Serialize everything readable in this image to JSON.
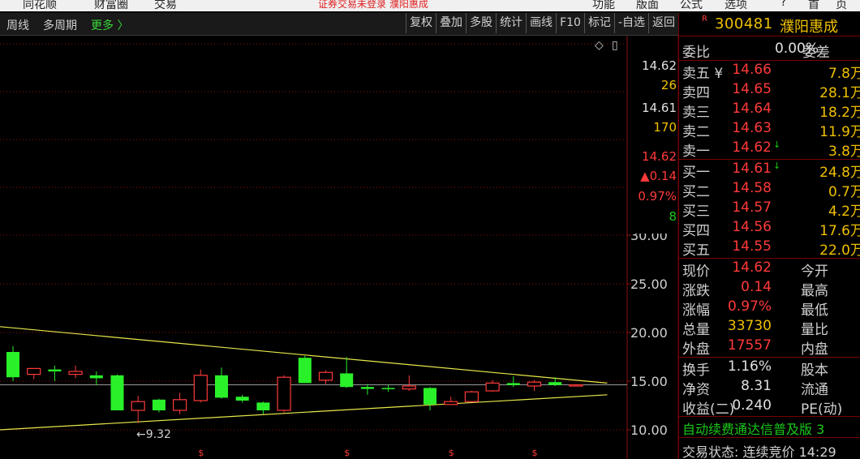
{
  "menubar": {
    "items": [
      "同花顺",
      "财富圈",
      "交易"
    ],
    "warning": "证券交易未登录  濮阳惠成",
    "right_items": [
      "功能",
      "版面",
      "公式",
      "选项",
      "?",
      "首",
      "页"
    ]
  },
  "toolbar": {
    "left": [
      "周线",
      "多周期"
    ],
    "more": "更多 〉",
    "right": [
      "复权",
      "叠加",
      "多股",
      "统计",
      "画线",
      "F10",
      "标记",
      "-自选",
      "返回"
    ]
  },
  "chart": {
    "corner_icons": [
      "◇",
      "▯"
    ],
    "mini_quotes": [
      {
        "text": "14.62",
        "color": "#e0e0e0"
      },
      {
        "text": "26",
        "color": "#f0c000"
      },
      {
        "text": "14.61",
        "color": "#e0e0e0"
      },
      {
        "text": "170",
        "color": "#f0c000"
      },
      {
        "text": "14.62",
        "color": "#ff3a3a"
      },
      {
        "text": "▲0.14",
        "color": "#ff3a3a"
      },
      {
        "text": "0.97%",
        "color": "#ff3a3a"
      },
      {
        "text": "8",
        "color": "#19c819"
      }
    ],
    "low_label": "←9.32",
    "marker": "$"
  },
  "chart_data": {
    "type": "candlestick",
    "y_ticks": [
      "30.00",
      "25.00",
      "20.00",
      "15.00",
      "10.00"
    ],
    "ylim": [
      10,
      30
    ],
    "candles": [
      {
        "o": 18.0,
        "h": 18.6,
        "l": 15.0,
        "c": 15.4
      },
      {
        "o": 15.7,
        "h": 16.3,
        "l": 15.2,
        "c": 16.3
      },
      {
        "o": 16.2,
        "h": 16.6,
        "l": 15.0,
        "c": 16.0
      },
      {
        "o": 15.7,
        "h": 16.6,
        "l": 15.3,
        "c": 16.0
      },
      {
        "o": 15.6,
        "h": 16.0,
        "l": 14.6,
        "c": 15.3
      },
      {
        "o": 15.6,
        "h": 15.7,
        "l": 12.0,
        "c": 12.0
      },
      {
        "o": 12.0,
        "h": 13.5,
        "l": 10.7,
        "c": 12.9
      },
      {
        "o": 13.1,
        "h": 13.2,
        "l": 11.8,
        "c": 12.0
      },
      {
        "o": 12.0,
        "h": 13.8,
        "l": 11.6,
        "c": 13.1
      },
      {
        "o": 13.0,
        "h": 16.2,
        "l": 12.8,
        "c": 15.6
      },
      {
        "o": 15.6,
        "h": 16.4,
        "l": 13.2,
        "c": 13.3
      },
      {
        "o": 13.4,
        "h": 13.6,
        "l": 12.8,
        "c": 13.0
      },
      {
        "o": 12.8,
        "h": 12.9,
        "l": 11.6,
        "c": 12.0
      },
      {
        "o": 12.0,
        "h": 15.6,
        "l": 11.8,
        "c": 15.4
      },
      {
        "o": 17.4,
        "h": 17.6,
        "l": 14.8,
        "c": 14.8
      },
      {
        "o": 15.1,
        "h": 16.1,
        "l": 14.7,
        "c": 15.9
      },
      {
        "o": 15.8,
        "h": 17.5,
        "l": 14.3,
        "c": 14.4
      },
      {
        "o": 14.4,
        "h": 14.7,
        "l": 13.6,
        "c": 14.2
      },
      {
        "o": 14.3,
        "h": 14.6,
        "l": 13.9,
        "c": 14.2
      },
      {
        "o": 14.2,
        "h": 15.6,
        "l": 14.0,
        "c": 14.5
      },
      {
        "o": 14.3,
        "h": 14.4,
        "l": 12.0,
        "c": 12.6
      },
      {
        "o": 12.6,
        "h": 13.4,
        "l": 12.6,
        "c": 12.9
      },
      {
        "o": 12.9,
        "h": 14.0,
        "l": 12.9,
        "c": 13.9
      },
      {
        "o": 14.0,
        "h": 15.1,
        "l": 13.9,
        "c": 14.8
      },
      {
        "o": 14.8,
        "h": 15.5,
        "l": 14.4,
        "c": 14.6
      },
      {
        "o": 14.5,
        "h": 15.1,
        "l": 14.0,
        "c": 14.9
      },
      {
        "o": 14.9,
        "h": 15.4,
        "l": 14.5,
        "c": 14.6
      },
      {
        "o": 14.6,
        "h": 14.7,
        "l": 14.6,
        "c": 14.62
      }
    ],
    "current_price": 14.62,
    "trendlines": [
      {
        "from": [
          0,
          20.6
        ],
        "to": [
          28.5,
          14.8
        ]
      },
      {
        "from": [
          0,
          10.0
        ],
        "to": [
          28.5,
          13.6
        ]
      }
    ],
    "low": 9.32
  },
  "quote": {
    "r_mark": "R",
    "code": "300481",
    "name": "濮阳惠成",
    "weibi_label": "委比",
    "weibi_value": "0.00%",
    "weicha_label": "委差",
    "asks": [
      {
        "label": "卖五 ¥",
        "price": "14.66",
        "arrow": "",
        "qty": "7.8万"
      },
      {
        "label": "卖四",
        "price": "14.65",
        "arrow": "",
        "qty": "28.1万"
      },
      {
        "label": "卖三",
        "price": "14.64",
        "arrow": "",
        "qty": "18.2万"
      },
      {
        "label": "卖二",
        "price": "14.63",
        "arrow": "",
        "qty": "11.9万"
      },
      {
        "label": "卖一",
        "price": "14.62",
        "arrow": "↓",
        "qty": "3.8万"
      }
    ],
    "bids": [
      {
        "label": "买一",
        "price": "14.61",
        "arrow": "↓",
        "qty": "24.8万"
      },
      {
        "label": "买二",
        "price": "14.58",
        "arrow": "",
        "qty": "0.7万"
      },
      {
        "label": "买三",
        "price": "14.57",
        "arrow": "",
        "qty": "4.2万"
      },
      {
        "label": "买四",
        "price": "14.56",
        "arrow": "",
        "qty": "17.6万"
      },
      {
        "label": "买五",
        "price": "14.55",
        "arrow": "",
        "qty": "22.0万"
      }
    ],
    "stats": [
      {
        "label": "现价",
        "value": "14.62",
        "vcolor": "#ff3a3a",
        "label2": "今开"
      },
      {
        "label": "涨跌",
        "value": "0.14",
        "vcolor": "#ff3a3a",
        "label2": "最高"
      },
      {
        "label": "涨幅",
        "value": "0.97%",
        "vcolor": "#ff3a3a",
        "label2": "最低"
      },
      {
        "label": "总量",
        "value": "33730",
        "vcolor": "#f0c000",
        "label2": "量比"
      },
      {
        "label": "外盘",
        "value": "17557",
        "vcolor": "#ff3a3a",
        "label2": "内盘"
      }
    ],
    "stats2": [
      {
        "label": "换手",
        "value": "1.16%",
        "vcolor": "#e0e0e0",
        "label2": "股本"
      },
      {
        "label": "净资",
        "value": "8.31",
        "vcolor": "#e0e0e0",
        "label2": "流通"
      },
      {
        "label": "收益(二)",
        "value": "0.240",
        "vcolor": "#e0e0e0",
        "label2": "PE(动)"
      }
    ],
    "news": "自动续费通达信普及版  3",
    "status": "交易状态: 连续竞价 14:29"
  }
}
